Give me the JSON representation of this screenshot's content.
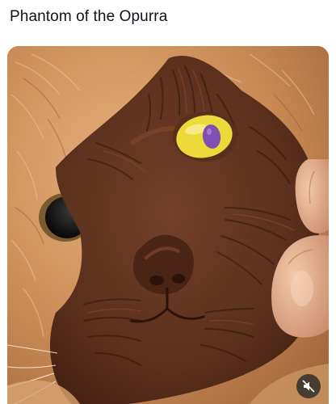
{
  "post": {
    "title": "Phantom of the Opurra"
  },
  "media": {
    "description_icon": "speaker-muted-icon",
    "colors": {
      "fur": "#c98a55",
      "chocolate": "#5a2f1c",
      "eye_yellow": "#ecd93a",
      "eye_purple": "#7f4fb4",
      "skin": "#e9b896",
      "mute_bg": "#262626"
    }
  }
}
